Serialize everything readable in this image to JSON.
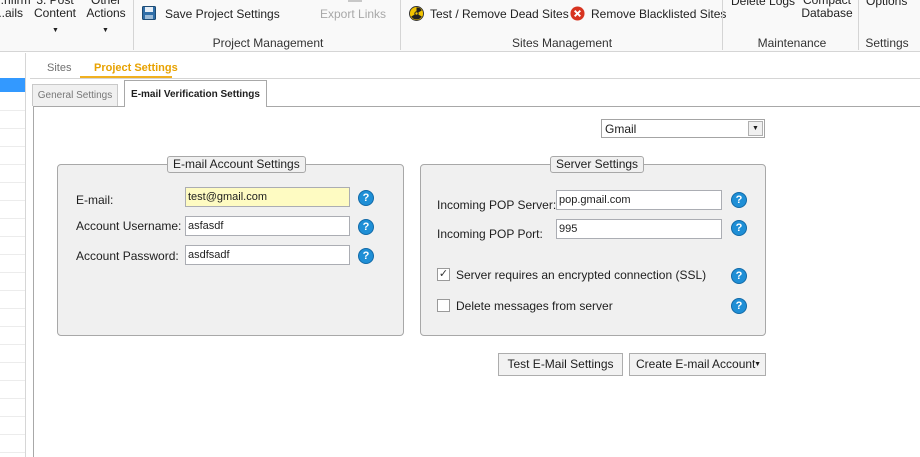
{
  "ribbon": {
    "confirm_label": "...nfirm\n...ails",
    "post_content_label": "3. Post\nContent",
    "other_actions_label": "Other\nActions",
    "save_project_settings": "Save Project Settings",
    "export_links": "Export Links",
    "project_management_group": "Project Management",
    "test_remove_dead_sites": "Test / Remove Dead Sites",
    "remove_blacklisted_sites": "Remove Blacklisted Sites",
    "sites_management_group": "Sites Management",
    "delete_logs": "Delete Logs",
    "compact_database": "Compact\nDatabase",
    "maintenance_group": "Maintenance",
    "options": "Options",
    "settings_group": "Settings"
  },
  "tabs": {
    "sites": "Sites",
    "project_settings": "Project Settings"
  },
  "subtabs": {
    "general": "General Settings",
    "email_verification": "E-mail Verification Settings"
  },
  "provider": {
    "selected": "Gmail"
  },
  "email_account": {
    "legend": "E-mail Account Settings",
    "email_label": "E-mail:",
    "email_value": "test@gmail.com",
    "username_label": "Account Username:",
    "username_value": "asfasdf",
    "password_label": "Account Password:",
    "password_value": "asdfsadf"
  },
  "server": {
    "legend": "Server Settings",
    "pop_server_label": "Incoming POP Server:",
    "pop_server_value": "pop.gmail.com",
    "pop_port_label": "Incoming POP Port:",
    "pop_port_value": "995",
    "ssl_label": "Server requires an encrypted connection (SSL)",
    "ssl_checked": true,
    "delete_label": "Delete messages from server",
    "delete_checked": false
  },
  "buttons": {
    "test_email": "Test E-Mail Settings",
    "create_email": "Create E-mail Account"
  },
  "icons": {
    "save": "floppy-disk-icon",
    "export": "export-icon",
    "test_remove": "radiation-icon",
    "remove_blacklisted": "red-x-circle-icon",
    "help": "question-mark-icon",
    "dropdown": "chevron-down-icon"
  },
  "colors": {
    "accent_tab": "#e8a200",
    "help_icon": "#1f8fd6",
    "focused_field": "#fefbc2",
    "selection": "#3399ff"
  }
}
